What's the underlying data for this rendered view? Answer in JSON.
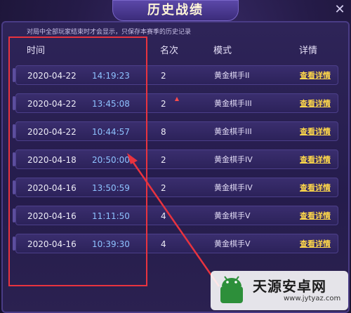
{
  "dialog": {
    "title": "历史战绩",
    "close_glyph": "✕",
    "notice": "对局中全部玩家结束时才会显示，只保存本赛季的历史记录"
  },
  "columns": {
    "time": "时间",
    "rank": "名次",
    "mode": "模式",
    "detail": "详情"
  },
  "rows": [
    {
      "date": "2020-04-22",
      "time": "14:19:23",
      "rank": "2",
      "mode": "黄金棋手II",
      "detail": "查看详情",
      "rank_up": false
    },
    {
      "date": "2020-04-22",
      "time": "13:45:08",
      "rank": "2",
      "mode": "黄金棋手III",
      "detail": "查看详情",
      "rank_up": true
    },
    {
      "date": "2020-04-22",
      "time": "10:44:57",
      "rank": "8",
      "mode": "黄金棋手III",
      "detail": "查看详情",
      "rank_up": false
    },
    {
      "date": "2020-04-18",
      "time": "20:50:00",
      "rank": "2",
      "mode": "黄金棋手IV",
      "detail": "查看详情",
      "rank_up": false
    },
    {
      "date": "2020-04-16",
      "time": "13:50:59",
      "rank": "2",
      "mode": "黄金棋手IV",
      "detail": "查看详情",
      "rank_up": false
    },
    {
      "date": "2020-04-16",
      "time": "11:11:50",
      "rank": "4",
      "mode": "黄金棋手V",
      "detail": "查看详情",
      "rank_up": false
    },
    {
      "date": "2020-04-16",
      "time": "10:39:30",
      "rank": "4",
      "mode": "黄金棋手V",
      "detail": "查看详情",
      "rank_up": false
    }
  ],
  "annotation": {
    "box_color": "#e8333f",
    "arrow_color": "#e8333f"
  },
  "watermark": {
    "title": "天源安卓网",
    "url": "www.jytyaz.com"
  },
  "colors": {
    "time_text": "#8ec2ff",
    "detail_link": "#ffd84a",
    "panel_bg": "#2e2458"
  }
}
